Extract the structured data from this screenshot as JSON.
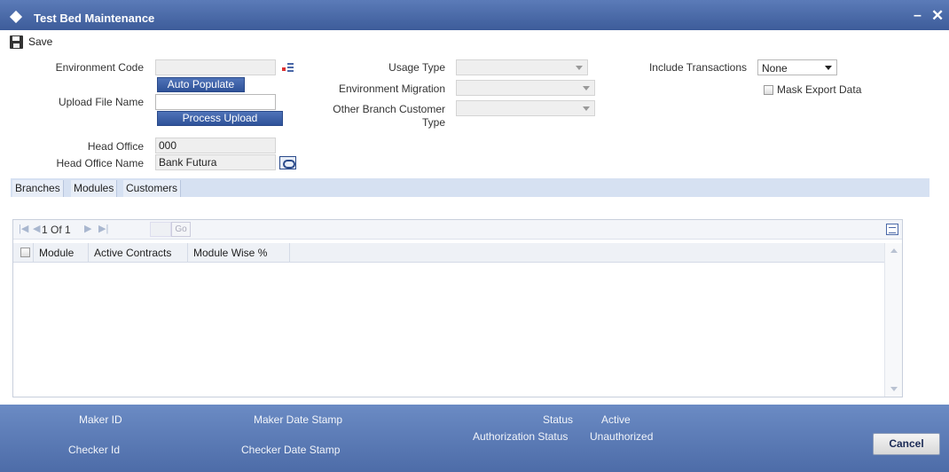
{
  "window": {
    "title": "Test Bed Maintenance",
    "minimize_glyph": "–",
    "close_glyph": "✕"
  },
  "toolbar": {
    "save_label": "Save",
    "save_icon": "floppy-disk-icon"
  },
  "form": {
    "environment_code": {
      "label": "Environment Code",
      "value": ""
    },
    "auto_populate_label": "Auto Populate",
    "upload_file_name": {
      "label": "Upload File Name",
      "value": ""
    },
    "process_upload_label": "Process Upload",
    "head_office": {
      "label": "Head Office",
      "value": "000"
    },
    "head_office_name": {
      "label": "Head Office Name",
      "value": "Bank Futura"
    },
    "usage_type": {
      "label": "Usage Type",
      "value": ""
    },
    "environment_migration": {
      "label": "Environment Migration",
      "value": ""
    },
    "other_branch_customer_type": {
      "label_line1": "Other Branch Customer",
      "label_line2": "Type",
      "value": ""
    },
    "include_transactions": {
      "label": "Include Transactions",
      "value": "None"
    },
    "mask_export_data": {
      "label": "Mask Export Data",
      "checked": false
    }
  },
  "tabs": [
    {
      "label": "Branches"
    },
    {
      "label": "Modules"
    },
    {
      "label": "Customers"
    }
  ],
  "grid": {
    "pager": {
      "page_text": "1 Of 1",
      "go_label": "Go",
      "page_input": ""
    },
    "columns": [
      "Module",
      "Active Contracts",
      "Module Wise %"
    ],
    "rows": []
  },
  "footer": {
    "maker_id_label": "Maker ID",
    "maker_date_stamp_label": "Maker Date Stamp",
    "checker_id_label": "Checker Id",
    "checker_date_stamp_label": "Checker Date Stamp",
    "status_label": "Status",
    "status_value": "Active",
    "authorization_status_label": "Authorization Status",
    "authorization_status_value": "Unauthorized",
    "cancel_label": "Cancel"
  }
}
